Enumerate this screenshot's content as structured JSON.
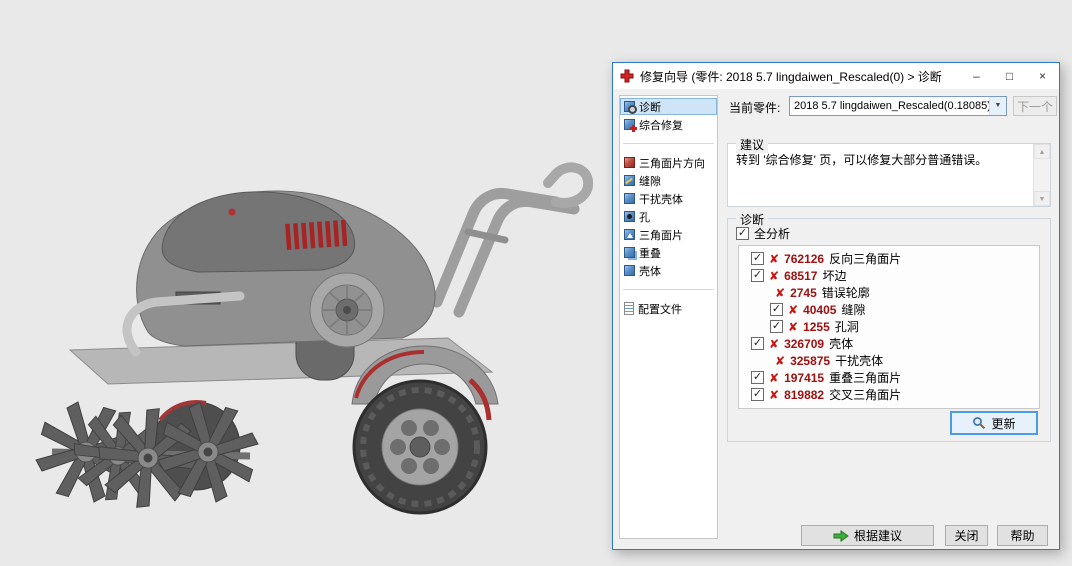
{
  "window": {
    "title": "修复向导 (零件: 2018 5.7  lingdaiwen_Rescaled(0) > 诊断"
  },
  "header": {
    "current_part_label": "当前零件:",
    "current_part_value": "2018 5.7 lingdaiwen_Rescaled(0.18085)",
    "next_button": "下一个"
  },
  "sidebar": {
    "top_items": [
      {
        "label": "诊断"
      },
      {
        "label": "综合修复"
      }
    ],
    "category_items": [
      {
        "label": "三角面片方向"
      },
      {
        "label": "缝隙"
      },
      {
        "label": "干扰壳体"
      },
      {
        "label": "孔"
      },
      {
        "label": "三角面片"
      },
      {
        "label": "重叠"
      },
      {
        "label": "壳体"
      }
    ],
    "profile_item": {
      "label": "配置文件"
    }
  },
  "suggestion": {
    "title": "建议",
    "text": "转到 '综合修复' 页，可以修复大部分普通错误。"
  },
  "diagnosis": {
    "title": "诊断",
    "full_analysis_label": "全分析",
    "items": [
      {
        "count": "762126",
        "label": "反向三角面片"
      },
      {
        "count": "68517",
        "label": "坏边"
      },
      {
        "count": "2745",
        "label": "错误轮廓"
      },
      {
        "count": "40405",
        "label": "缝隙"
      },
      {
        "count": "1255",
        "label": "孔洞"
      },
      {
        "count": "326709",
        "label": "壳体"
      },
      {
        "count": "325875",
        "label": "干扰壳体"
      },
      {
        "count": "197415",
        "label": "重叠三角面片"
      },
      {
        "count": "819882",
        "label": "交叉三角面片"
      }
    ],
    "update_button": "更新"
  },
  "footer": {
    "apply_button": "根据建议",
    "close_button": "关闭",
    "help_button": "帮助"
  },
  "icons": {
    "minimize": "–",
    "maximize": "□",
    "close": "×",
    "dropdown": "▼",
    "scroll_up": "▲",
    "scroll_down": "▼",
    "check": "✓",
    "error_x": "✘"
  },
  "colors": {
    "dialog_border": "#2f7ac5",
    "error_red": "#cc1111",
    "count_red": "#a01010",
    "selection_blue": "#cfe5f7",
    "update_focus_blue": "#4d9be6",
    "apply_green": "#3fae3f"
  }
}
